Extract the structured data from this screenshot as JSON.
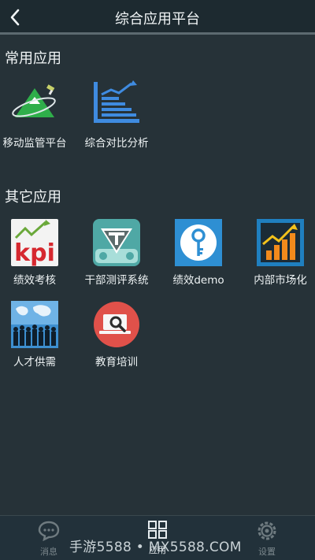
{
  "header": {
    "title": "综合应用平台"
  },
  "sections": {
    "common": {
      "title": "常用应用",
      "apps": [
        {
          "label": "移动监管平台",
          "icon": "mountain-satellite-icon"
        },
        {
          "label": "综合对比分析",
          "icon": "rising-chart-icon"
        }
      ]
    },
    "other": {
      "title": "其它应用",
      "apps": [
        {
          "label": "绩效考核",
          "icon": "kpi-icon"
        },
        {
          "label": "干部测评系统",
          "icon": "t-evaluation-icon"
        },
        {
          "label": "绩效demo",
          "icon": "key-icon"
        },
        {
          "label": "内部市场化",
          "icon": "bar-growth-icon"
        },
        {
          "label": "人才供需",
          "icon": "world-people-icon"
        },
        {
          "label": "教育培训",
          "icon": "laptop-search-icon"
        }
      ]
    }
  },
  "bottom_nav": {
    "items": [
      {
        "label": "消息",
        "icon": "chat-bubble-icon"
      },
      {
        "label": "应用",
        "icon": "grid-icon"
      },
      {
        "label": "设置",
        "icon": "gear-icon"
      }
    ],
    "active": "应用"
  },
  "watermark": "手游5588 • MX5588.COM",
  "colors": {
    "background": "#263238",
    "header": "#1d2a30",
    "nav": "#22313a"
  }
}
